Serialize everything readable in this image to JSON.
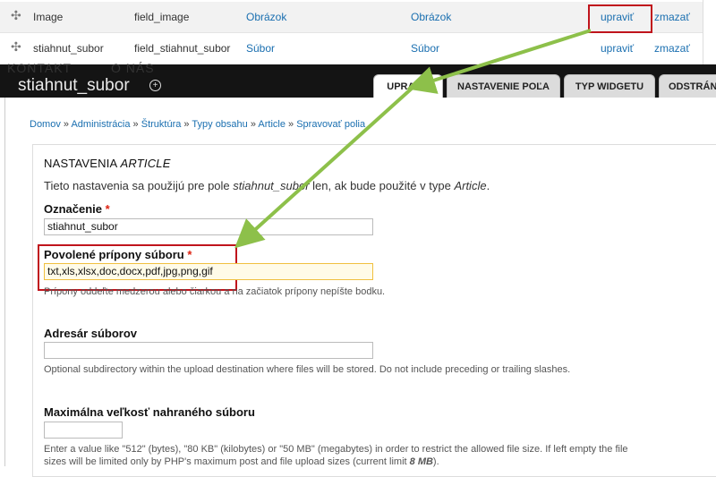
{
  "fields_table": {
    "rows": [
      {
        "label": "Image",
        "machine": "field_image",
        "type": "Obrázok",
        "widget": "Obrázok",
        "edit": "upraviť",
        "delete": "zmazať"
      },
      {
        "label": "stiahnut_subor",
        "machine": "field_stiahnut_subor",
        "type": "Súbor",
        "widget": "Súbor",
        "edit": "upraviť",
        "delete": "zmazať"
      }
    ]
  },
  "header": {
    "ghost_menu": [
      "KONTAKT",
      "O NÁS"
    ],
    "title": "stiahnut_subor",
    "tabs": [
      "UPRAVIŤ",
      "NASTAVENIE POĽA",
      "TYP WIDGETU",
      "ODSTRÁN"
    ]
  },
  "breadcrumb": [
    "Domov",
    "Administrácia",
    "Štruktúra",
    "Typy obsahu",
    "Article",
    "Spravovať polia"
  ],
  "settings": {
    "legend_prefix": "NASTAVENIA ",
    "legend_em": "ARTICLE",
    "intro_prefix": "Tieto nastavenia sa použijú pre pole ",
    "intro_field": "stiahnut_subor",
    "intro_mid": " len, ak bude použité v type ",
    "intro_type": "Article",
    "intro_end": ".",
    "label_title": "Označenie",
    "label_value": "stiahnut_subor",
    "ext_title": "Povolené prípony súboru",
    "ext_value": "txt,xls,xlsx,doc,docx,pdf,jpg,png,gif",
    "ext_help": "Prípony oddeľte medzerou alebo čiarkou a na začiatok prípony nepíšte bodku.",
    "dir_title": "Adresár súborov",
    "dir_value": "",
    "dir_help": "Optional subdirectory within the upload destination where files will be stored. Do not include preceding or trailing slashes.",
    "size_title": "Maximálna veľkosť nahraného súboru",
    "size_value": "",
    "size_help_1": "Enter a value like \"512\" (bytes), \"80 KB\" (kilobytes) or \"50 MB\" (megabytes) in order to restrict the allowed file size. If left empty the file",
    "size_help_2_prefix": "sizes will be limited only by PHP's maximum post and file upload sizes (current limit ",
    "size_help_2_limit": "8 MB",
    "size_help_2_end": ").",
    "required_mark": "*"
  },
  "colors": {
    "link": "#1a6fb0",
    "highlight": "#c0141c",
    "arrow": "#8dc04a",
    "header_bg": "#141414"
  }
}
